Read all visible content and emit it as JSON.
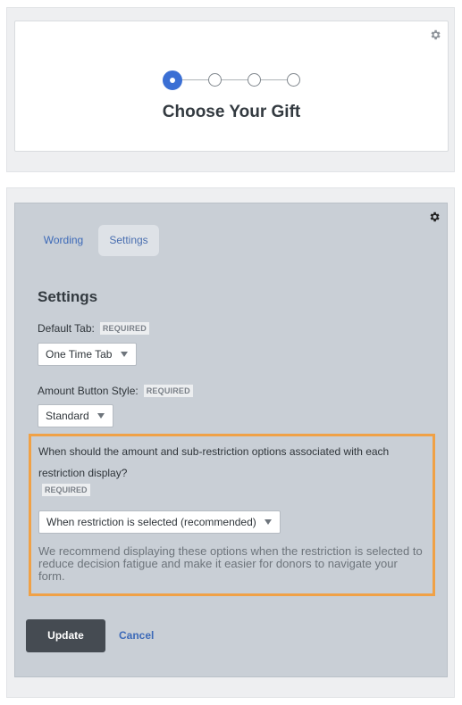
{
  "stepper": {
    "title": "Choose Your Gift",
    "steps": 4,
    "active_step": 1,
    "accent_color": "#3b6fd4"
  },
  "icons": {
    "settings": "gear-icon"
  },
  "tabs": [
    {
      "label": "Wording",
      "active": false
    },
    {
      "label": "Settings",
      "active": true
    }
  ],
  "settings": {
    "title": "Settings",
    "default_tab": {
      "label": "Default Tab:",
      "required": "REQUIRED",
      "value": "One Time Tab"
    },
    "amount_button_style": {
      "label": "Amount Button Style:",
      "required": "REQUIRED",
      "value": "Standard"
    },
    "restriction_display": {
      "question": "When should the amount and sub-restriction options associated with each restriction display?",
      "required": "REQUIRED",
      "value": "When restriction is selected (recommended)",
      "hint": "We recommend displaying these options when the restriction is selected to reduce decision fatigue and make it easier for donors to navigate your form.",
      "highlight_color": "#f0a146"
    }
  },
  "actions": {
    "update_label": "Update",
    "cancel_label": "Cancel"
  }
}
